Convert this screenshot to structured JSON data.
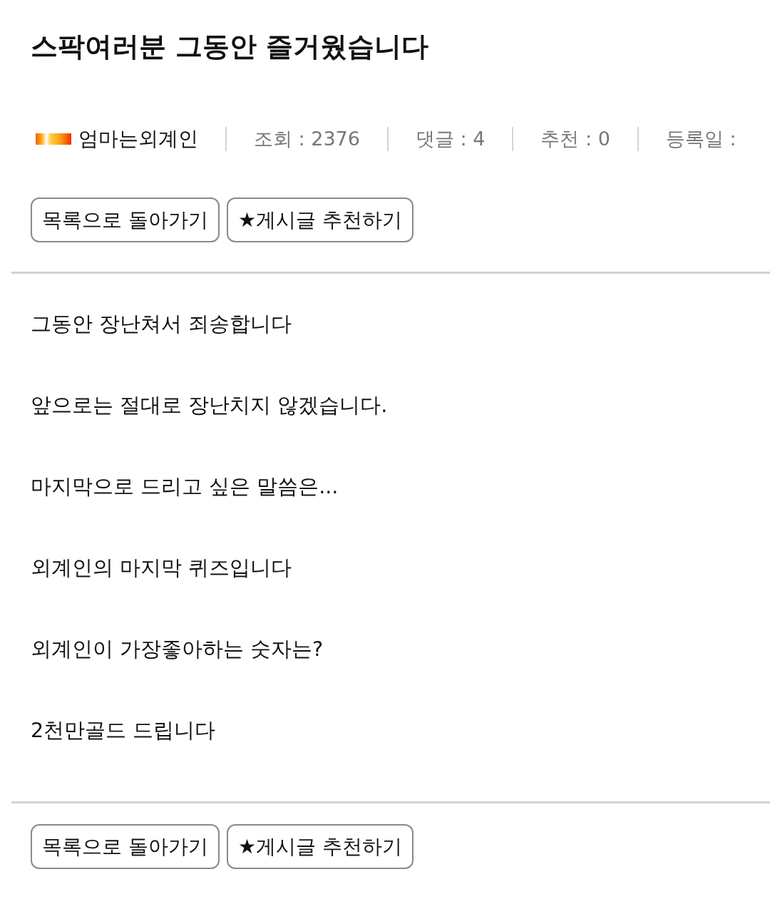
{
  "post": {
    "title": "스팍여러분 그동안 즐거웠습니다"
  },
  "meta": {
    "author": "엄마는외계인",
    "stats": [
      "조회 : 2376",
      "댓글 : 4",
      "추천 : 0",
      "등록일 :"
    ]
  },
  "top_buttons": [
    "목록으로 돌아가기",
    "★게시글 추천하기"
  ],
  "body": [
    "그동안 장난쳐서 죄송합니다",
    "앞으로는 절대로 장난치지 않겠습니다.",
    "마지막으로 드리고 싶은 말씀은...",
    "외계인의 마지막 퀴즈입니다",
    "외계인이 가장좋아하는 숫자는?",
    "2천만골드 드립니다"
  ],
  "bottom_buttons": [
    "목록으로 돌아가기",
    "★게시글 추천하기"
  ]
}
